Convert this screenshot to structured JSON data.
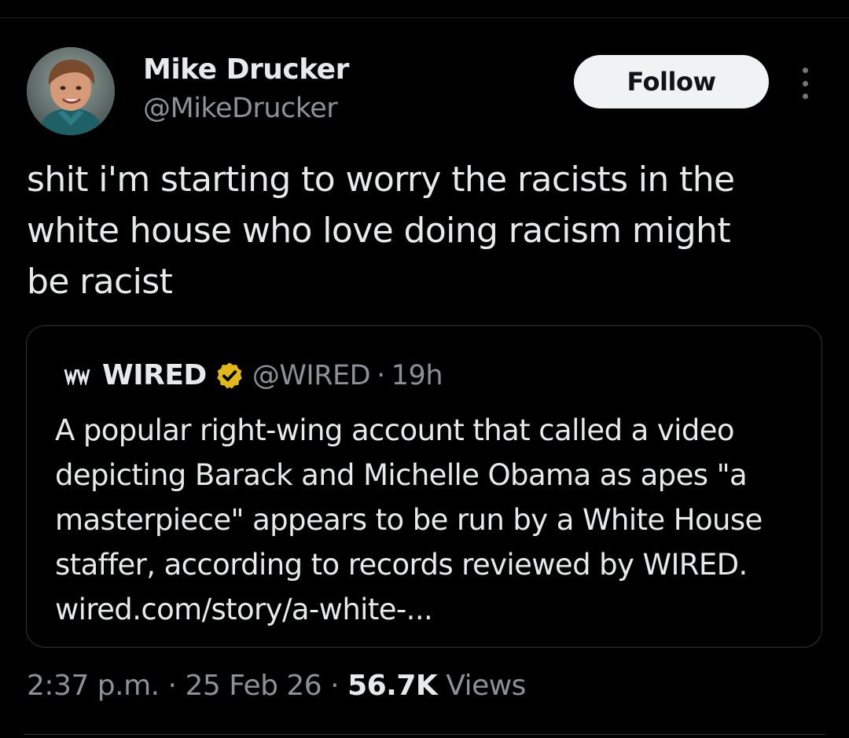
{
  "author": {
    "name": "Mike Drucker",
    "handle": "@MikeDrucker",
    "avatar_icon": "profile-photo"
  },
  "follow_label": "Follow",
  "more_icon": "more-vertical-icon",
  "tweet": {
    "lines": [
      "shit i'm starting to worry the racists in the",
      "white house who love doing racism might",
      "be racist"
    ]
  },
  "quote": {
    "logo_icon": "wired-logo",
    "name": "WIRED",
    "verified_icon": "verified-gold-badge",
    "verified_color": "#e2b719",
    "handle": "@WIRED",
    "separator": "·",
    "time": "19h",
    "lines": [
      "A popular right-wing account that called a video",
      "depicting Barack and Michelle Obama as apes \"a",
      "masterpiece\" appears to be run by a White House",
      "staffer, according to records reviewed by WIRED.",
      "wired.com/story/a-white-..."
    ]
  },
  "meta": {
    "time": "2:37 p.m.",
    "sep1": "·",
    "date": "25 Feb 26",
    "sep2": "·",
    "views_count": "56.7K",
    "views_label": "Views"
  },
  "colors": {
    "background": "#000000",
    "text": "#e7e9ea",
    "secondary_text": "#8b9196",
    "border": "#2f3336",
    "follow_bg": "#eff3f4"
  }
}
